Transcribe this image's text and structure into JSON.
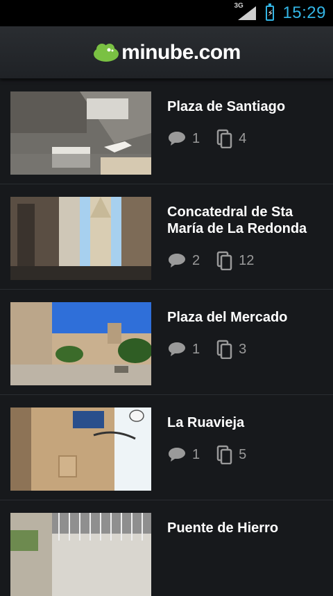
{
  "status_bar": {
    "network": "3G",
    "time": "15:29"
  },
  "header": {
    "logo_text": "minube.com"
  },
  "places": [
    {
      "title": "Plaza de Santiago",
      "comments": "1",
      "photos": "4"
    },
    {
      "title": "Concatedral de Sta María de La Redonda",
      "comments": "2",
      "photos": "12"
    },
    {
      "title": "Plaza del Mercado",
      "comments": "1",
      "photos": "3"
    },
    {
      "title": "La Ruavieja",
      "comments": "1",
      "photos": "5"
    },
    {
      "title": "Puente de Hierro",
      "comments": "",
      "photos": ""
    }
  ],
  "icons": {
    "comment": "speech-bubble-icon",
    "photos": "photo-stack-icon"
  },
  "colors": {
    "accent": "#33b5e5",
    "brand": "#7ac143",
    "background": "#17191c"
  }
}
